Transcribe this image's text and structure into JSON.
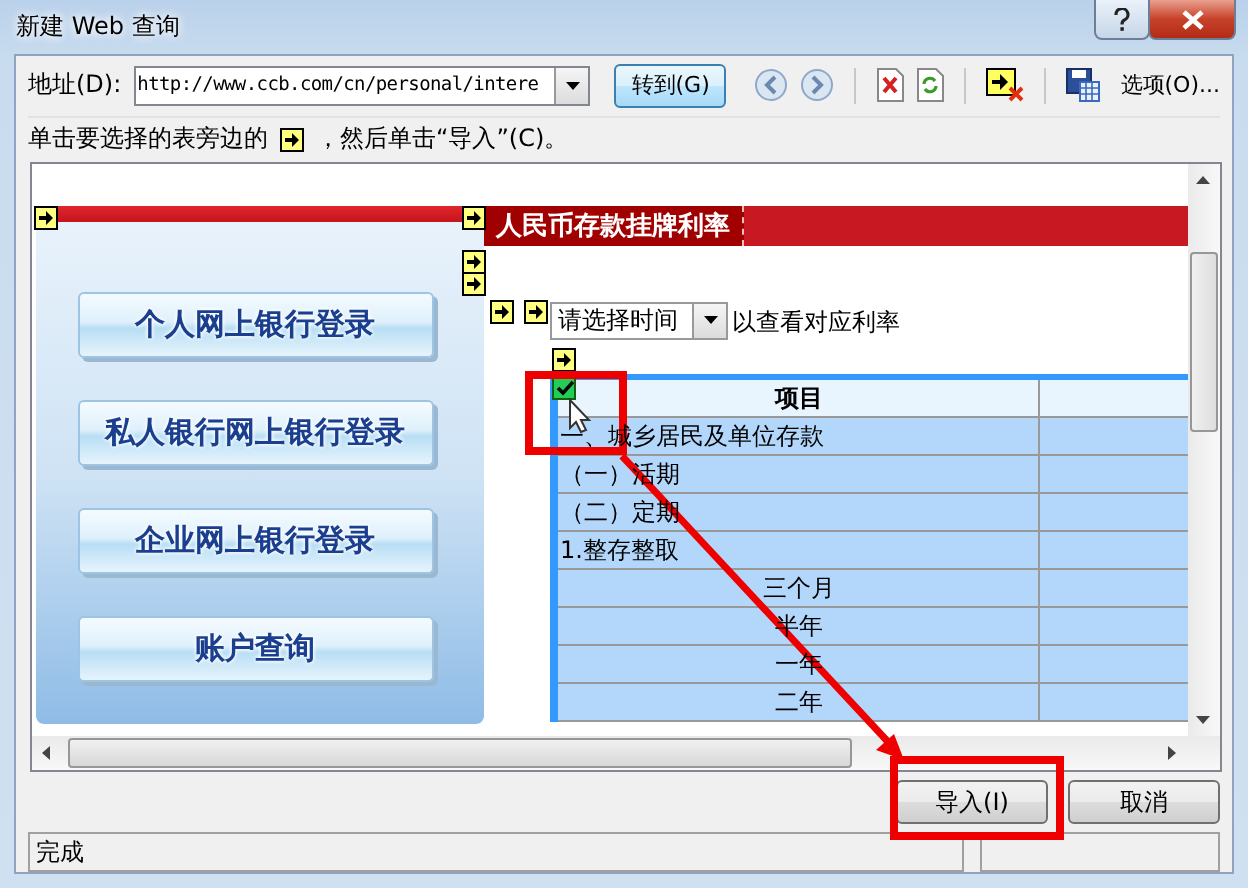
{
  "window": {
    "title": "新建 Web 查询"
  },
  "address": {
    "label": "地址(D):",
    "value": "http://www.ccb.com/cn/personal/intere"
  },
  "go_button": "转到(G)",
  "options_button": "选项(O)...",
  "instruction": {
    "before": "单击要选择的表旁边的",
    "after": "，然后单击“导入”(C)。"
  },
  "web_page": {
    "side_buttons": [
      "个人网上银行登录",
      "私人银行网上银行登录",
      "企业网上银行登录",
      "账户查询"
    ],
    "heading": "人民币存款挂牌利率",
    "time_select": {
      "value": "请选择时间"
    },
    "select_hint": "以查看对应利率",
    "table": {
      "checked": true,
      "columns": [
        "项目"
      ],
      "rows": [
        {
          "text": "一、城乡居民及单位存款",
          "kind": "category"
        },
        {
          "text": "（一）活期",
          "kind": "category"
        },
        {
          "text": "（二）定期",
          "kind": "category"
        },
        {
          "text": "1.整存整取",
          "kind": "category"
        },
        {
          "text": "三个月",
          "kind": "term"
        },
        {
          "text": "半年",
          "kind": "term"
        },
        {
          "text": "一年",
          "kind": "term"
        },
        {
          "text": "二年",
          "kind": "term"
        }
      ]
    }
  },
  "buttons": [
    {
      "label": "导入(I)"
    },
    {
      "label": "取消"
    }
  ],
  "status_bar": {
    "text": "完成"
  }
}
